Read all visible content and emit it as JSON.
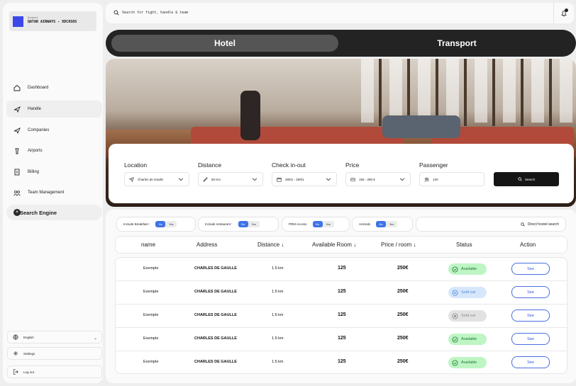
{
  "brand": {
    "small": "Airport",
    "name": "QATAR AIRWAYS - XDC0SOS"
  },
  "sidebar": {
    "items": [
      {
        "label": "Dashboard",
        "icon": "home-icon"
      },
      {
        "label": "Handle",
        "icon": "plane-icon"
      },
      {
        "label": "Companies",
        "icon": "plane-icon"
      },
      {
        "label": "Airports",
        "icon": "tower-icon"
      },
      {
        "label": "Billing",
        "icon": "bill-icon"
      },
      {
        "label": "Team Management",
        "icon": "team-icon"
      }
    ],
    "engine": {
      "label": "Search Engine",
      "icon_glyph": "+"
    },
    "utilities": [
      {
        "label": "English",
        "icon": "globe-icon"
      },
      {
        "label": "Settings",
        "icon": "gear-icon"
      },
      {
        "label": "Log out",
        "icon": "logout-icon"
      }
    ]
  },
  "topbar": {
    "search_placeholder": "Search for fight, handle & team"
  },
  "tabs": {
    "hotel": "Hotel",
    "transport": "Transport"
  },
  "search_form": {
    "location": {
      "label": "Location",
      "value": "Charles de Gaulle"
    },
    "distance": {
      "label": "Distance",
      "value": "50 Km"
    },
    "checkin": {
      "label": "Check in-out",
      "value": "28/01 - 29/01"
    },
    "price": {
      "label": "Price",
      "value": "150 - 290 €"
    },
    "passenger": {
      "label": "Passenger",
      "value": "120"
    },
    "search_button": "Search"
  },
  "filters": {
    "breakfast": {
      "label": "Include Breakfast :",
      "no": "No",
      "yes": "Yes"
    },
    "restaurant": {
      "label": "Include restaurant :",
      "no": "No",
      "yes": "Yes"
    },
    "prm": {
      "label": "PRM Access",
      "no": "No",
      "yes": "Yes"
    },
    "animals": {
      "label": "Animals",
      "no": "No",
      "yes": "Yes"
    },
    "direct_search": "Direct hostel search"
  },
  "table": {
    "headers": {
      "name": "name",
      "address": "Address",
      "distance": "Distance ↓",
      "available": "Available Room ↓",
      "price": "Price / room ↓",
      "status": "Status",
      "action": "Action"
    },
    "rows": [
      {
        "name": "Exemple",
        "address": "CHARLES DE GAULLE",
        "distance": "1.5 km",
        "available": "125",
        "price": "250€",
        "status": "Available",
        "action": "See"
      },
      {
        "name": "Exemple",
        "address": "CHARLES DE GAULLE",
        "distance": "1.5 km",
        "available": "125",
        "price": "250€",
        "status": "Sold out",
        "action": "See"
      },
      {
        "name": "Exemple",
        "address": "CHARLES DE GAULLE",
        "distance": "1.5 km",
        "available": "125",
        "price": "250€",
        "status": "Sold out",
        "action": "See"
      },
      {
        "name": "Exemple",
        "address": "CHARLES DE GAULLE",
        "distance": "1.5 km",
        "available": "125",
        "price": "250€",
        "status": "Available",
        "action": "See"
      },
      {
        "name": "Exemple",
        "address": "CHARLES DE GAULLE",
        "distance": "1.5 km",
        "available": "125",
        "price": "250€",
        "status": "Available",
        "action": "See"
      }
    ]
  },
  "colors": {
    "accent": "#3f73e6",
    "available_bg": "#bff5c5",
    "available_fg": "#1f7a2e",
    "soldout_blue_bg": "#d7e7fb",
    "soldout_blue_fg": "#4f86d6",
    "soldout_grey_bg": "#e2e2e2",
    "soldout_grey_fg": "#8a8a8a"
  }
}
